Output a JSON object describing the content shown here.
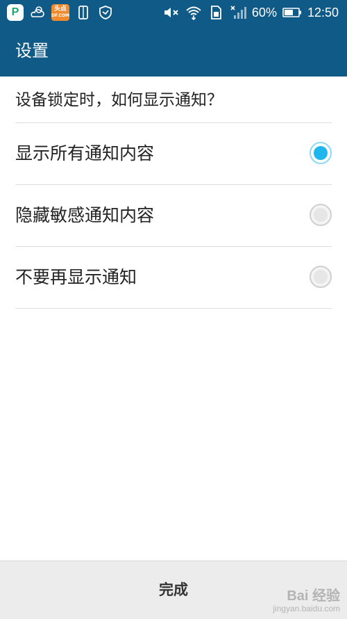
{
  "status_bar": {
    "left_icons": [
      "app-p-icon",
      "weather-icon",
      "news-app-icon",
      "phone-icon",
      "shield-icon"
    ],
    "news_app_text": [
      "头点",
      "DF.COM"
    ],
    "right_icons": [
      "mute-icon",
      "wifi-icon",
      "sim-icon",
      "signal-icon",
      "battery-icon"
    ],
    "battery": "60%",
    "time": "12:50"
  },
  "app_bar": {
    "title": "设置"
  },
  "question": "设备锁定时，如何显示通知？",
  "options": [
    {
      "label": "显示所有通知内容",
      "selected": true
    },
    {
      "label": "隐藏敏感通知内容",
      "selected": false
    },
    {
      "label": "不要再显示通知",
      "selected": false
    }
  ],
  "done_label": "完成",
  "watermark": {
    "line1": "Bai 经验",
    "line2": "jingyan.baidu.com"
  },
  "colors": {
    "bar_bg": "#0f5a86",
    "radio_selected": "#1fb5ee"
  }
}
